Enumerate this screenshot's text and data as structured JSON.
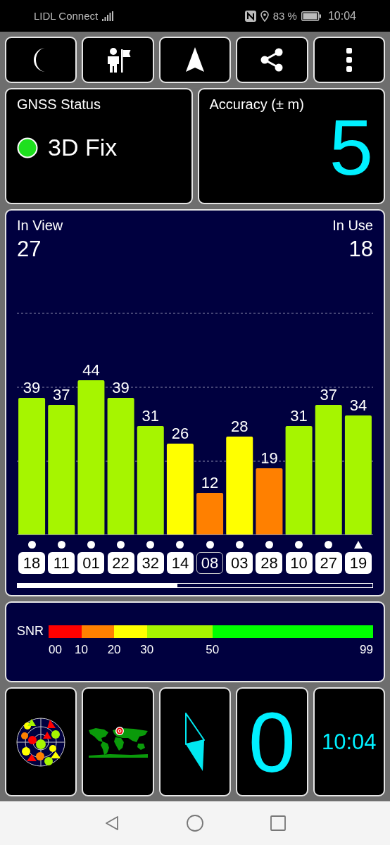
{
  "status_bar": {
    "carrier": "LIDL Connect",
    "battery": "83 %",
    "time": "10:04"
  },
  "toolbar": [
    {
      "kind": "moon"
    },
    {
      "kind": "person_flag"
    },
    {
      "kind": "navigation"
    },
    {
      "kind": "share"
    },
    {
      "kind": "more"
    }
  ],
  "gnss_status": {
    "title": "GNSS Status",
    "value": "3D Fix"
  },
  "accuracy": {
    "title": "Accuracy (± m)",
    "value": "5"
  },
  "satellites": {
    "in_view_label": "In View",
    "in_view": "27",
    "in_use_label": "In Use",
    "in_use": "18",
    "chart_data": {
      "type": "bar",
      "categories": [
        "18",
        "11",
        "01",
        "22",
        "32",
        "14",
        "08",
        "03",
        "28",
        "10",
        "27",
        "19"
      ],
      "values": [
        39,
        37,
        44,
        39,
        31,
        26,
        12,
        28,
        19,
        31,
        37,
        34
      ],
      "data_labels": true
    },
    "markers": [
      {
        "kind": "dot",
        "used": true
      },
      {
        "kind": "dot",
        "used": true
      },
      {
        "kind": "dot",
        "used": true
      },
      {
        "kind": "dot",
        "used": true
      },
      {
        "kind": "dot",
        "used": true
      },
      {
        "kind": "dot",
        "used": true
      },
      {
        "kind": "dot",
        "used": false
      },
      {
        "kind": "dot",
        "used": true
      },
      {
        "kind": "dot",
        "used": true
      },
      {
        "kind": "dot",
        "used": true
      },
      {
        "kind": "dot",
        "used": true
      },
      {
        "kind": "triangle",
        "used": true
      }
    ]
  },
  "snr_legend": {
    "label": "SNR",
    "ticks": [
      "00",
      "10",
      "20",
      "30",
      "50",
      "99"
    ],
    "segments": [
      {
        "color": "#ff0000"
      },
      {
        "color": "#ff8000"
      },
      {
        "color": "#ffff00"
      },
      {
        "color": "#a6f500"
      },
      {
        "color": "#00ff00"
      }
    ]
  },
  "tiles": [
    {
      "kind": "sky_plot"
    },
    {
      "kind": "world_map"
    },
    {
      "kind": "compass"
    },
    {
      "kind": "value",
      "text": "0"
    },
    {
      "kind": "clock",
      "text": "10:04"
    }
  ]
}
